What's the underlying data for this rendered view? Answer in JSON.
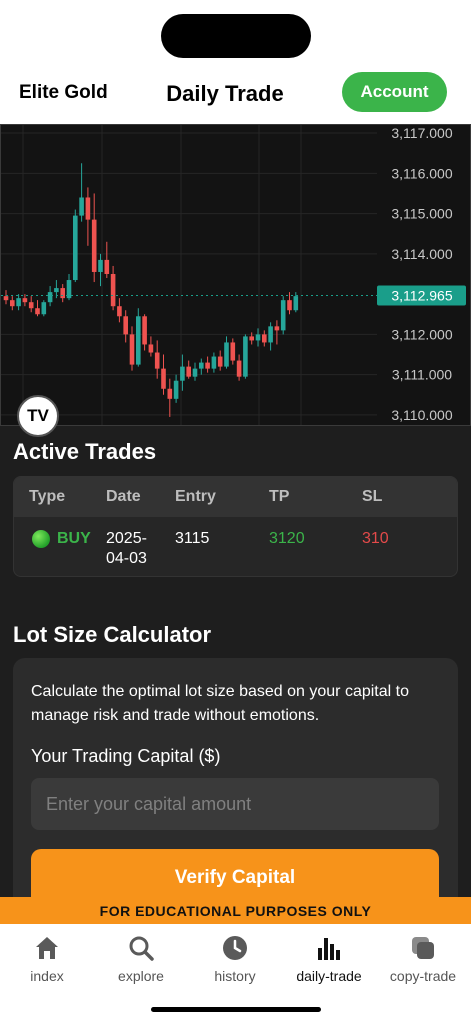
{
  "header": {
    "brand": "Elite Gold",
    "title": "Daily Trade",
    "account_label": "Account"
  },
  "chart_data": {
    "type": "candlestick",
    "ylim": [
      3109.75,
      3117.2
    ],
    "y_ticks": [
      "3,117.000",
      "3,116.000",
      "3,115.000",
      "3,114.000",
      "3,112.000",
      "3,111.000",
      "3,110.000"
    ],
    "y_tick_values": [
      3117,
      3116,
      3115,
      3114,
      3112,
      3111,
      3110
    ],
    "current_price": 3112.965,
    "current_price_label": "3,112.965",
    "colors": {
      "up": "#26a69a",
      "down": "#ef5350",
      "price_tag": "#1a9e8a"
    },
    "candles": [
      {
        "o": 3112.95,
        "h": 3113.1,
        "l": 3112.75,
        "c": 3112.85
      },
      {
        "o": 3112.85,
        "h": 3112.95,
        "l": 3112.6,
        "c": 3112.7
      },
      {
        "o": 3112.7,
        "h": 3113.0,
        "l": 3112.6,
        "c": 3112.9
      },
      {
        "o": 3112.9,
        "h": 3113.0,
        "l": 3112.7,
        "c": 3112.8
      },
      {
        "o": 3112.8,
        "h": 3112.95,
        "l": 3112.55,
        "c": 3112.65
      },
      {
        "o": 3112.65,
        "h": 3112.85,
        "l": 3112.45,
        "c": 3112.5
      },
      {
        "o": 3112.5,
        "h": 3112.85,
        "l": 3112.45,
        "c": 3112.8
      },
      {
        "o": 3112.8,
        "h": 3113.2,
        "l": 3112.7,
        "c": 3113.05
      },
      {
        "o": 3113.05,
        "h": 3113.35,
        "l": 3112.9,
        "c": 3113.15
      },
      {
        "o": 3113.15,
        "h": 3113.25,
        "l": 3112.8,
        "c": 3112.9
      },
      {
        "o": 3112.9,
        "h": 3113.5,
        "l": 3112.85,
        "c": 3113.35
      },
      {
        "o": 3113.35,
        "h": 3115.1,
        "l": 3113.3,
        "c": 3114.95
      },
      {
        "o": 3114.95,
        "h": 3116.25,
        "l": 3114.8,
        "c": 3115.4
      },
      {
        "o": 3115.4,
        "h": 3115.65,
        "l": 3114.2,
        "c": 3114.85
      },
      {
        "o": 3114.85,
        "h": 3115.5,
        "l": 3113.3,
        "c": 3113.55
      },
      {
        "o": 3113.55,
        "h": 3114.0,
        "l": 3113.2,
        "c": 3113.85
      },
      {
        "o": 3113.85,
        "h": 3114.3,
        "l": 3113.4,
        "c": 3113.5
      },
      {
        "o": 3113.5,
        "h": 3113.7,
        "l": 3112.6,
        "c": 3112.7
      },
      {
        "o": 3112.7,
        "h": 3112.9,
        "l": 3112.3,
        "c": 3112.45
      },
      {
        "o": 3112.45,
        "h": 3112.6,
        "l": 3111.8,
        "c": 3112.0
      },
      {
        "o": 3112.0,
        "h": 3112.2,
        "l": 3111.1,
        "c": 3111.25
      },
      {
        "o": 3111.25,
        "h": 3112.65,
        "l": 3111.2,
        "c": 3112.45
      },
      {
        "o": 3112.45,
        "h": 3112.5,
        "l": 3111.6,
        "c": 3111.75
      },
      {
        "o": 3111.75,
        "h": 3111.95,
        "l": 3111.45,
        "c": 3111.55
      },
      {
        "o": 3111.55,
        "h": 3111.85,
        "l": 3110.9,
        "c": 3111.15
      },
      {
        "o": 3111.15,
        "h": 3111.5,
        "l": 3110.5,
        "c": 3110.65
      },
      {
        "o": 3110.65,
        "h": 3110.9,
        "l": 3109.95,
        "c": 3110.4
      },
      {
        "o": 3110.4,
        "h": 3111.0,
        "l": 3110.3,
        "c": 3110.85
      },
      {
        "o": 3110.85,
        "h": 3111.5,
        "l": 3110.6,
        "c": 3111.2
      },
      {
        "o": 3111.2,
        "h": 3111.35,
        "l": 3110.9,
        "c": 3110.95
      },
      {
        "o": 3110.95,
        "h": 3111.3,
        "l": 3110.85,
        "c": 3111.15
      },
      {
        "o": 3111.15,
        "h": 3111.4,
        "l": 3111.0,
        "c": 3111.3
      },
      {
        "o": 3111.3,
        "h": 3111.45,
        "l": 3111.05,
        "c": 3111.15
      },
      {
        "o": 3111.15,
        "h": 3111.55,
        "l": 3111.05,
        "c": 3111.45
      },
      {
        "o": 3111.45,
        "h": 3111.6,
        "l": 3111.1,
        "c": 3111.2
      },
      {
        "o": 3111.2,
        "h": 3111.95,
        "l": 3111.15,
        "c": 3111.8
      },
      {
        "o": 3111.8,
        "h": 3111.9,
        "l": 3111.25,
        "c": 3111.35
      },
      {
        "o": 3111.35,
        "h": 3111.5,
        "l": 3110.85,
        "c": 3110.95
      },
      {
        "o": 3110.95,
        "h": 3112.0,
        "l": 3110.9,
        "c": 3111.95
      },
      {
        "o": 3111.95,
        "h": 3112.05,
        "l": 3111.75,
        "c": 3111.85
      },
      {
        "o": 3111.85,
        "h": 3112.15,
        "l": 3111.7,
        "c": 3112.0
      },
      {
        "o": 3112.0,
        "h": 3112.1,
        "l": 3111.7,
        "c": 3111.8
      },
      {
        "o": 3111.8,
        "h": 3112.3,
        "l": 3111.6,
        "c": 3112.2
      },
      {
        "o": 3112.2,
        "h": 3112.35,
        "l": 3111.75,
        "c": 3112.1
      },
      {
        "o": 3112.1,
        "h": 3112.95,
        "l": 3112.0,
        "c": 3112.85
      },
      {
        "o": 3112.85,
        "h": 3113.05,
        "l": 3112.5,
        "c": 3112.6
      },
      {
        "o": 3112.6,
        "h": 3113.05,
        "l": 3112.55,
        "c": 3112.95
      }
    ]
  },
  "active_trades": {
    "title": "Active Trades",
    "columns": [
      "Type",
      "Date",
      "Entry",
      "TP",
      "SL"
    ],
    "rows": [
      {
        "type": "BUY",
        "date_line1": "2025-",
        "date_line2": "04-03",
        "entry": "3115",
        "tp": "3120",
        "sl": "310"
      }
    ]
  },
  "calculator": {
    "title": "Lot Size Calculator",
    "description": "Calculate the optimal lot size based on your capital to manage risk and trade without emotions.",
    "capital_label": "Your Trading Capital ($)",
    "capital_placeholder": "Enter your capital amount",
    "capital_value": "",
    "verify_label": "Verify Capital"
  },
  "banner": {
    "text": "FOR EDUCATIONAL PURPOSES ONLY"
  },
  "tabs": [
    {
      "label": "index",
      "icon": "home-icon"
    },
    {
      "label": "explore",
      "icon": "search-icon"
    },
    {
      "label": "history",
      "icon": "clock-icon"
    },
    {
      "label": "daily-trade",
      "icon": "bar-chart-icon"
    },
    {
      "label": "copy-trade",
      "icon": "copy-icon"
    }
  ]
}
